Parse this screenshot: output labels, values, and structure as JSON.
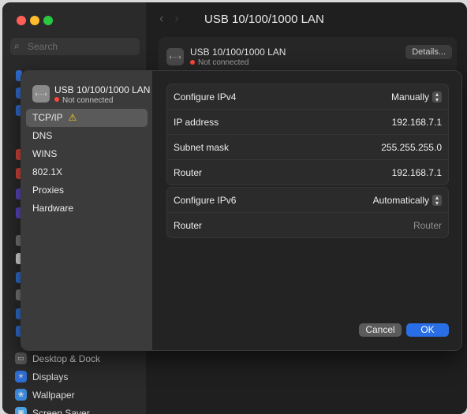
{
  "window": {
    "title": "USB 10/100/1000 LAN",
    "search_placeholder": "Search",
    "card": {
      "name": "USB 10/100/1000 LAN",
      "status": "Not connected",
      "details_label": "Details..."
    },
    "sidebar_items": [
      {
        "label": "Desktop & Dock",
        "icon": "desktop-dock-icon",
        "color": "#5a5a5a"
      },
      {
        "label": "Displays",
        "icon": "displays-icon",
        "color": "#2f6fd6"
      },
      {
        "label": "Wallpaper",
        "icon": "wallpaper-icon",
        "color": "#3a86d8"
      },
      {
        "label": "Screen Saver",
        "icon": "screen-saver-icon",
        "color": "#4aa0e0"
      }
    ]
  },
  "sheet": {
    "interface": {
      "name": "USB 10/100/1000 LAN",
      "status": "Not connected",
      "icon_text": "‹···›"
    },
    "tabs": [
      {
        "label": "TCP/IP",
        "selected": true,
        "warning": "⚠"
      },
      {
        "label": "DNS"
      },
      {
        "label": "WINS"
      },
      {
        "label": "802.1X"
      },
      {
        "label": "Proxies"
      },
      {
        "label": "Hardware"
      }
    ],
    "ipv4": {
      "configure_label": "Configure IPv4",
      "configure_value": "Manually",
      "ip_label": "IP address",
      "ip_value": "192.168.7.1",
      "subnet_label": "Subnet mask",
      "subnet_value": "255.255.255.0",
      "router_label": "Router",
      "router_value": "192.168.7.1"
    },
    "ipv6": {
      "configure_label": "Configure IPv6",
      "configure_value": "Automatically",
      "router_label": "Router",
      "router_placeholder": "Router"
    },
    "buttons": {
      "cancel": "Cancel",
      "ok": "OK"
    },
    "colors": {
      "accent": "#2a6ee6",
      "status_red": "#ff453a",
      "warning": "#ffd60a"
    }
  }
}
